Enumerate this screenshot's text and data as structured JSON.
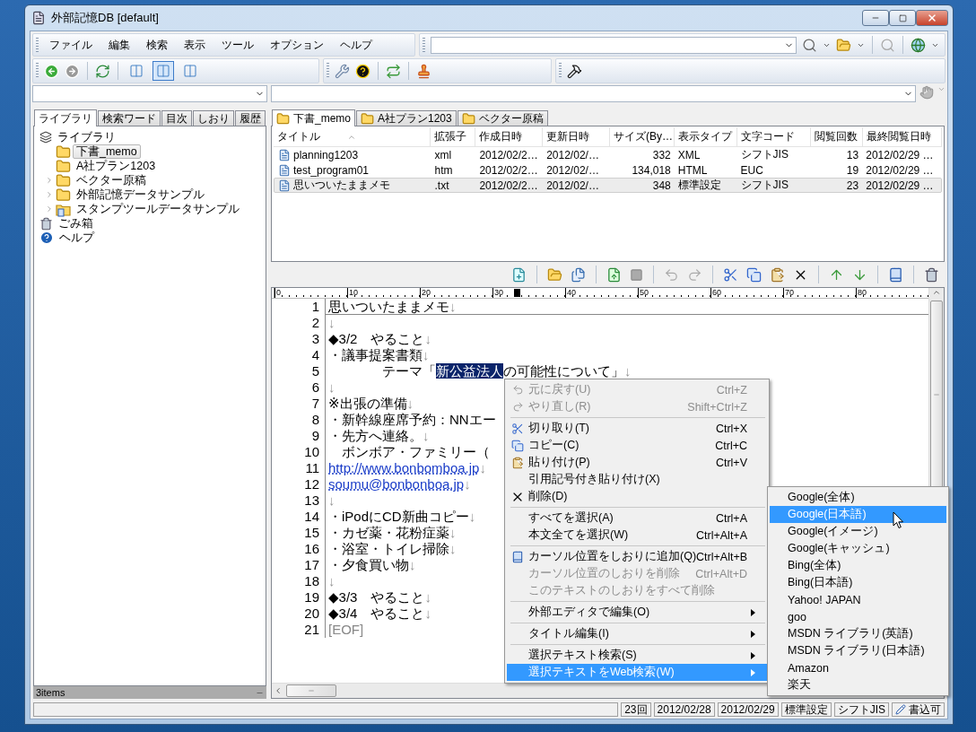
{
  "window": {
    "title": "外部記憶DB [default]"
  },
  "menu_bar": [
    "ファイル",
    "編集",
    "検索",
    "表示",
    "ツール",
    "オプション",
    "ヘルプ"
  ],
  "view_buttons": [
    {
      "selected": false
    },
    {
      "selected": true
    },
    {
      "selected": false
    }
  ],
  "left_panel": {
    "tabs": [
      {
        "label": "ライブラリ",
        "selected": true
      },
      {
        "label": "検索ワード",
        "selected": false
      },
      {
        "label": "目次",
        "selected": false
      },
      {
        "label": "しおり",
        "selected": false
      },
      {
        "label": "履歴",
        "selected": false
      }
    ],
    "tree": [
      {
        "label": "ライブラリ",
        "kind": "library",
        "selected": false,
        "expanded": true,
        "children": [
          {
            "label": "下書_memo",
            "kind": "folder",
            "selected": true
          },
          {
            "label": "A社プラン1203",
            "kind": "folder",
            "selected": false
          },
          {
            "label": "ベクター原稿",
            "kind": "folder",
            "selected": false,
            "expanded": false
          },
          {
            "label": "外部記憶データサンプル",
            "kind": "folder",
            "selected": false,
            "expanded": false
          },
          {
            "label": "スタンプツールデータサンプル",
            "kind": "stamp_folder",
            "selected": false,
            "expanded": false
          }
        ]
      },
      {
        "label": "ごみ箱",
        "kind": "trash",
        "selected": false
      },
      {
        "label": "ヘルプ",
        "kind": "help",
        "selected": false
      }
    ],
    "status": "3items"
  },
  "doc_tabs": [
    {
      "label": "下書_memo",
      "selected": true
    },
    {
      "label": "A社プラン1203",
      "selected": false
    },
    {
      "label": "ベクター原稿",
      "selected": false
    }
  ],
  "file_list": {
    "columns": [
      {
        "label": "タイトル"
      },
      {
        "label": "拡張子"
      },
      {
        "label": "作成日時"
      },
      {
        "label": "更新日時"
      },
      {
        "label": "サイズ(By…"
      },
      {
        "label": "表示タイプ"
      },
      {
        "label": "文字コード"
      },
      {
        "label": "閲覧回数"
      },
      {
        "label": "最終閲覧日時"
      }
    ],
    "rows": [
      {
        "selected": false,
        "cells": [
          "planning1203",
          "xml",
          "2012/02/2…",
          "2012/02/…",
          "332",
          "XML",
          "シフトJIS",
          "13",
          "2012/02/29 …"
        ]
      },
      {
        "selected": false,
        "cells": [
          "test_program01",
          "htm",
          "2012/02/2…",
          "2012/02/…",
          "134,018",
          "HTML",
          "EUC",
          "19",
          "2012/02/29 …"
        ]
      },
      {
        "selected": true,
        "cells": [
          "思いついたままメモ",
          ".txt",
          "2012/02/2…",
          "2012/02/…",
          "348",
          "標準設定",
          "シフトJIS",
          "23",
          "2012/02/29 …"
        ]
      }
    ]
  },
  "editor": {
    "ruler": [
      "0",
      "10",
      "20",
      "30",
      "40",
      "50",
      "60",
      "70",
      "80"
    ],
    "lines": [
      {
        "number": "1",
        "current": true,
        "segments": [
          {
            "text": "思いついたままメモ",
            "kind": "text"
          }
        ],
        "eol": "↓"
      },
      {
        "number": "2",
        "current": false,
        "eol": "↓"
      },
      {
        "number": "3",
        "current": false,
        "segments": [
          {
            "text": "◆3/2　やること",
            "kind": "text"
          }
        ],
        "eol": "↓"
      },
      {
        "number": "4",
        "current": false,
        "segments": [
          {
            "text": "・議事提案書類",
            "kind": "text"
          }
        ],
        "eol": "↓"
      },
      {
        "number": "5",
        "current": false,
        "segments": [
          {
            "text": "　　　　テーマ「",
            "kind": "text"
          },
          {
            "text": "新公益法人",
            "kind": "selected"
          },
          {
            "text": "の可能性について」",
            "kind": "text"
          }
        ],
        "eol": "↓"
      },
      {
        "number": "6",
        "current": false,
        "eol": "↓"
      },
      {
        "number": "7",
        "current": false,
        "segments": [
          {
            "text": "※出張の準備",
            "kind": "text"
          }
        ],
        "eol": "↓"
      },
      {
        "number": "8",
        "current": false,
        "segments": [
          {
            "text": "・新幹線座席予約：NNエー",
            "kind": "text"
          }
        ]
      },
      {
        "number": "9",
        "current": false,
        "segments": [
          {
            "text": "・先方へ連絡。",
            "kind": "text"
          }
        ],
        "eol": "↓"
      },
      {
        "number": "10",
        "current": false,
        "segments": [
          {
            "text": "　ボンボア・ファミリー（",
            "kind": "text"
          }
        ]
      },
      {
        "number": "11",
        "current": false,
        "segments": [
          {
            "text": "http://www.bonbomboa.jp",
            "kind": "link"
          }
        ],
        "eol": "↓"
      },
      {
        "number": "12",
        "current": false,
        "segments": [
          {
            "text": "soumu@bonbonboa.jp",
            "kind": "link"
          }
        ],
        "eol": "↓"
      },
      {
        "number": "13",
        "current": false,
        "eol": "↓"
      },
      {
        "number": "14",
        "current": false,
        "segments": [
          {
            "text": "・iPodにCD新曲コピー",
            "kind": "text"
          }
        ],
        "eol": "↓"
      },
      {
        "number": "15",
        "current": false,
        "segments": [
          {
            "text": "・カゼ薬・花粉症薬",
            "kind": "text"
          }
        ],
        "eol": "↓"
      },
      {
        "number": "16",
        "current": false,
        "segments": [
          {
            "text": "・浴室・トイレ掃除",
            "kind": "text"
          }
        ],
        "eol": "↓"
      },
      {
        "number": "17",
        "current": false,
        "segments": [
          {
            "text": "・夕食買い物",
            "kind": "text"
          }
        ],
        "eol": "↓"
      },
      {
        "number": "18",
        "current": false,
        "eol": "↓"
      },
      {
        "number": "19",
        "current": false,
        "segments": [
          {
            "text": "◆3/3　やること",
            "kind": "text"
          }
        ],
        "eol": "↓"
      },
      {
        "number": "20",
        "current": false,
        "segments": [
          {
            "text": "◆3/4　やること",
            "kind": "text"
          }
        ],
        "eol": "↓"
      },
      {
        "number": "21",
        "current": false,
        "segments": [
          {
            "text": "[EOF]",
            "kind": "eof"
          }
        ]
      }
    ]
  },
  "context_menu": {
    "items": [
      {
        "kind": "item",
        "label": "元に戻す(U)",
        "shortcut": "Ctrl+Z",
        "disabled": true,
        "selected": false
      },
      {
        "kind": "item",
        "label": "やり直し(R)",
        "shortcut": "Shift+Ctrl+Z",
        "disabled": true,
        "selected": false
      },
      {
        "kind": "separator"
      },
      {
        "kind": "item",
        "label": "切り取り(T)",
        "shortcut": "Ctrl+X",
        "disabled": false,
        "selected": false
      },
      {
        "kind": "item",
        "label": "コピー(C)",
        "shortcut": "Ctrl+C",
        "disabled": false,
        "selected": false
      },
      {
        "kind": "item",
        "label": "貼り付け(P)",
        "shortcut": "Ctrl+V",
        "disabled": false,
        "selected": false
      },
      {
        "kind": "item",
        "label": "引用記号付き貼り付け(X)",
        "disabled": false,
        "selected": false
      },
      {
        "kind": "item",
        "label": "削除(D)",
        "disabled": false,
        "selected": false
      },
      {
        "kind": "separator"
      },
      {
        "kind": "item",
        "label": "すべてを選択(A)",
        "shortcut": "Ctrl+A",
        "disabled": false,
        "selected": false
      },
      {
        "kind": "item",
        "label": "本文全てを選択(W)",
        "shortcut": "Ctrl+Alt+A",
        "disabled": false,
        "selected": false
      },
      {
        "kind": "separator"
      },
      {
        "kind": "item",
        "label": "カーソル位置をしおりに追加(Q)",
        "shortcut": "Ctrl+Alt+B",
        "disabled": false,
        "selected": false
      },
      {
        "kind": "item",
        "label": "カーソル位置のしおりを削除",
        "shortcut": "Ctrl+Alt+D",
        "disabled": true,
        "selected": false
      },
      {
        "kind": "item",
        "label": "このテキストのしおりをすべて削除",
        "disabled": true,
        "selected": false
      },
      {
        "kind": "separator"
      },
      {
        "kind": "item",
        "label": "外部エディタで編集(O)",
        "submenu": true,
        "disabled": false,
        "selected": false
      },
      {
        "kind": "separator"
      },
      {
        "kind": "item",
        "label": "タイトル編集(I)",
        "submenu": true,
        "disabled": false,
        "selected": false
      },
      {
        "kind": "separator"
      },
      {
        "kind": "item",
        "label": "選択テキスト検索(S)",
        "submenu": true,
        "disabled": false,
        "selected": false
      },
      {
        "kind": "item",
        "label": "選択テキストをWeb検索(W)",
        "submenu": true,
        "disabled": false,
        "selected": true
      }
    ]
  },
  "submenu": {
    "items": [
      {
        "label": "Google(全体)",
        "selected": false
      },
      {
        "label": "Google(日本語)",
        "selected": true
      },
      {
        "label": "Google(イメージ)",
        "selected": false
      },
      {
        "label": "Google(キャッシュ)",
        "selected": false
      },
      {
        "label": "Bing(全体)",
        "selected": false
      },
      {
        "label": "Bing(日本語)",
        "selected": false
      },
      {
        "label": "Yahoo! JAPAN",
        "selected": false
      },
      {
        "label": "goo",
        "selected": false
      },
      {
        "label": "MSDN ライブラリ(英語)",
        "selected": false
      },
      {
        "label": "MSDN ライブラリ(日本語)",
        "selected": false
      },
      {
        "label": "Amazon",
        "selected": false
      },
      {
        "label": "楽天",
        "selected": false
      }
    ]
  },
  "status_bar": {
    "fields": [
      {
        "text": "23回",
        "kind": "plain"
      },
      {
        "text": "2012/02/28",
        "kind": "plain"
      },
      {
        "text": "2012/02/29",
        "kind": "plain"
      },
      {
        "text": "標準設定",
        "kind": "plain"
      },
      {
        "text": "シフトJIS",
        "kind": "plain"
      },
      {
        "text": "書込可",
        "kind": "writable"
      }
    ]
  }
}
